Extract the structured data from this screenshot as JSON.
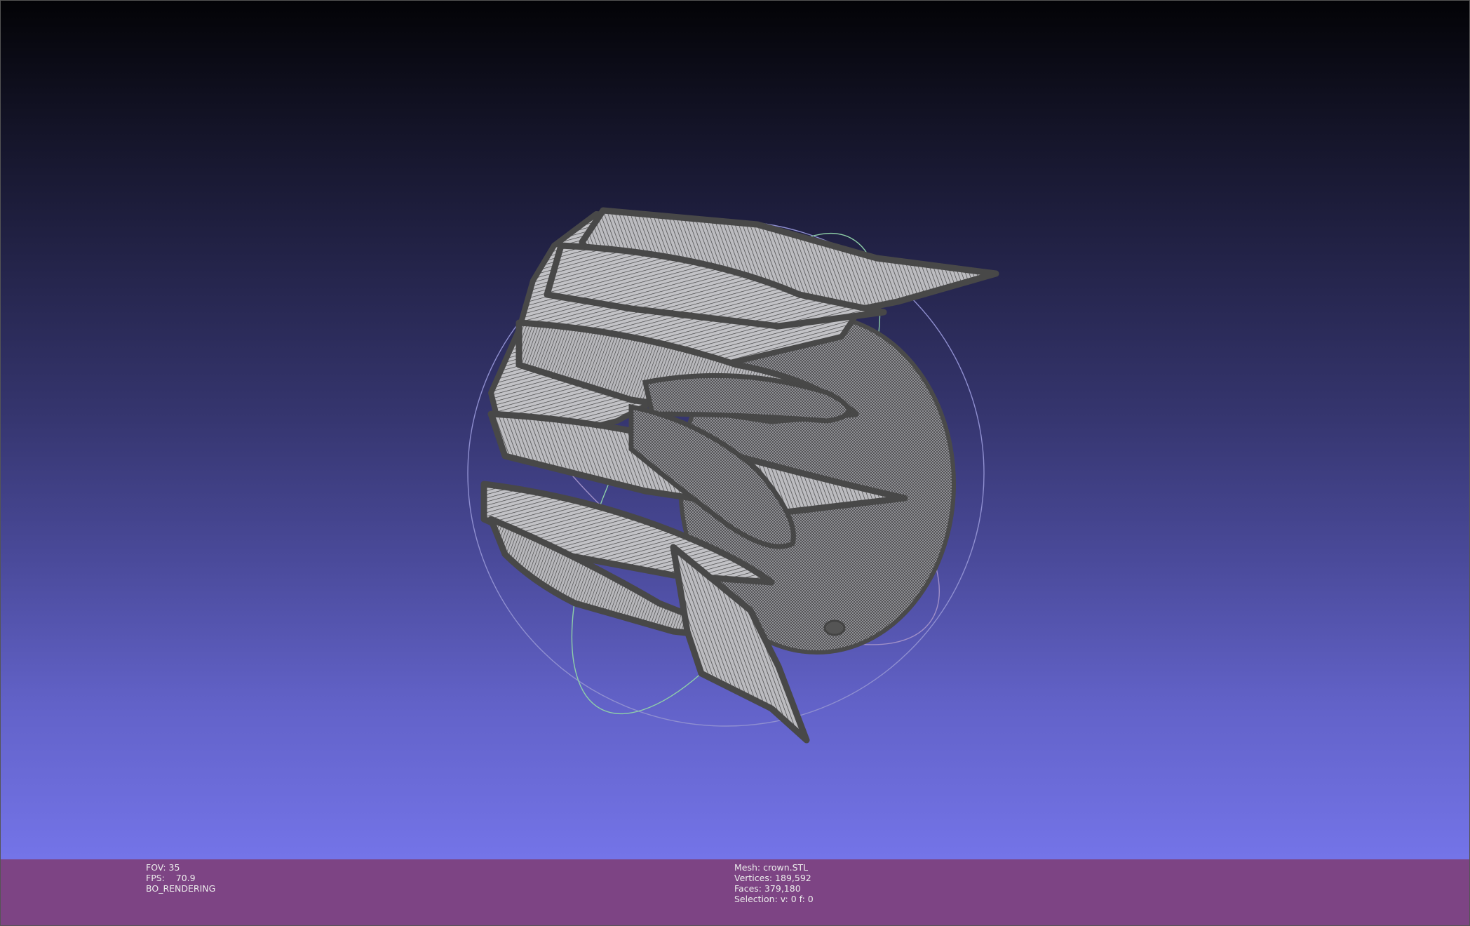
{
  "viewer": {
    "background_top": "#030306",
    "background_bottom": "#7474e8",
    "status_bar_color": "#7d4484",
    "mesh_wire_color": "#4a4a4a",
    "mesh_face_color": "#b4b4b8",
    "trackball_colors": [
      "#8f8fd0",
      "#8fd0a8",
      "#a090c8"
    ]
  },
  "status_left": {
    "fov": "FOV: 35",
    "fps": "FPS:    70.9",
    "render_mode": "BO_RENDERING"
  },
  "status_center": {
    "mesh": "Mesh: crown.STL",
    "vertices": "Vertices: 189,592",
    "faces": "Faces: 379,180",
    "selection": "Selection: v: 0 f: 0"
  }
}
